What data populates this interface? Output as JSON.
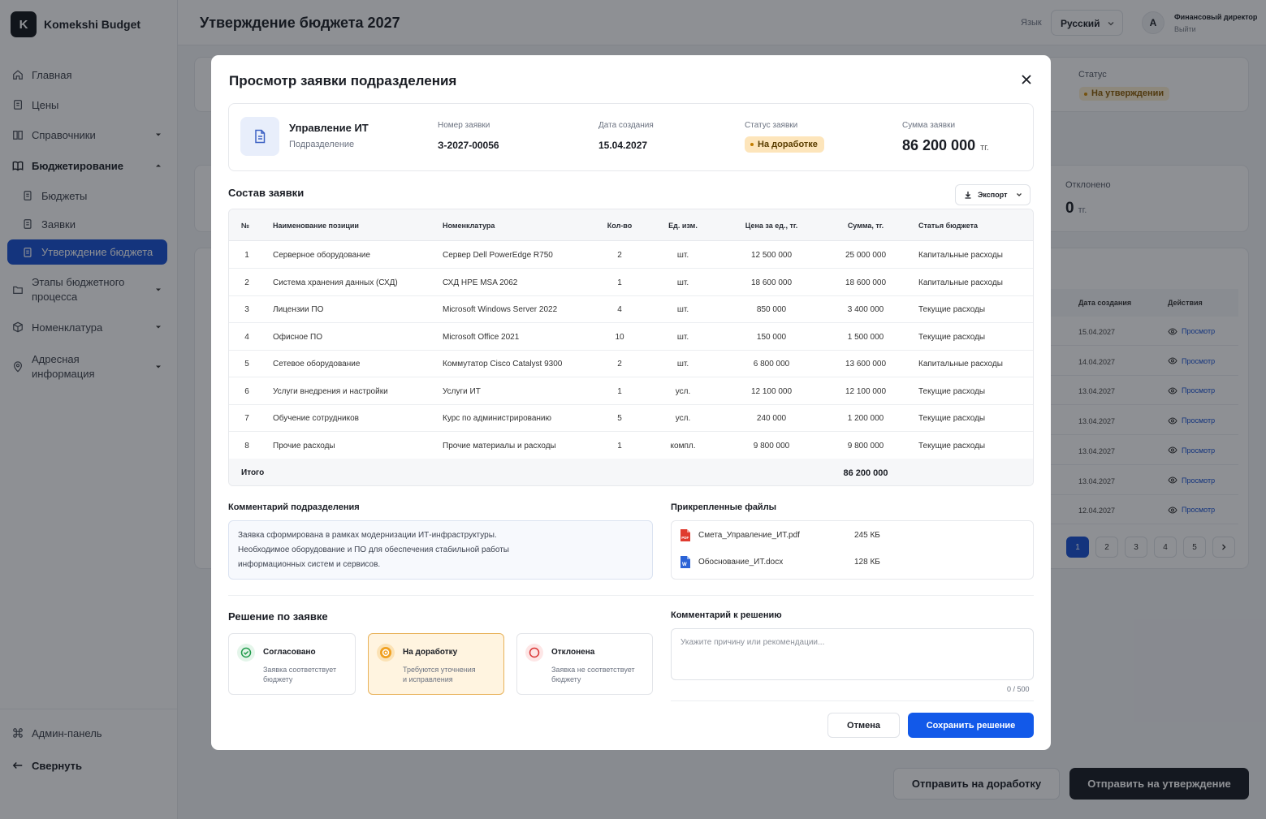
{
  "app": {
    "name": "Komekshi Budget",
    "logo_letter": "K"
  },
  "sidebar": {
    "items": [
      {
        "label": "Главная",
        "icon": "home-icon"
      },
      {
        "label": "Цены",
        "icon": "price-doc-icon"
      },
      {
        "label": "Справочники",
        "icon": "book-icon"
      },
      {
        "label": "Бюджетирование",
        "icon": "book-open-icon"
      },
      {
        "label": "Бюджеты",
        "icon": "file-icon"
      },
      {
        "label": "Заявки",
        "icon": "file-icon"
      },
      {
        "label": "Утверждение бюджета",
        "icon": "file-icon"
      },
      {
        "label": "Этапы бюджетного процесса",
        "icon": "folder-icon"
      },
      {
        "label": "Номенклатура",
        "icon": "box-icon"
      },
      {
        "label": "Адресная информация",
        "icon": "map-pin-icon"
      }
    ],
    "admin": "Админ-панель",
    "collapse": "Свернуть"
  },
  "header": {
    "title": "Утверждение бюджета 2027",
    "lang_label": "Язык",
    "lang_value": "Русский",
    "avatar": "А",
    "user_role": "Финансовый директор",
    "logout": "Выйти"
  },
  "background": {
    "status_label": "Статус",
    "status_value": "На утверждении",
    "rejected_label": "Отклонено",
    "rejected_value": "0",
    "currency": "тг.",
    "table_headers": [
      "Дата создания",
      "Действия"
    ],
    "rows": [
      {
        "date": "15.04.2027",
        "action": "Просмотр"
      },
      {
        "date": "14.04.2027",
        "action": "Просмотр"
      },
      {
        "date": "13.04.2027",
        "action": "Просмотр"
      },
      {
        "date": "13.04.2027",
        "action": "Просмотр"
      },
      {
        "date": "13.04.2027",
        "action": "Просмотр"
      },
      {
        "date": "13.04.2027",
        "action": "Просмотр"
      },
      {
        "date": "12.04.2027",
        "action": "Просмотр"
      }
    ],
    "pages": [
      "1",
      "2",
      "3",
      "4",
      "5"
    ],
    "btn_rework": "Отправить на доработку",
    "btn_approve": "Отправить на утверждение"
  },
  "modal": {
    "title": "Просмотр заявки подразделения",
    "department": "Управление ИТ",
    "department_sub": "Подразделение",
    "number_label": "Номер заявки",
    "number_value": "З-2027-00056",
    "date_label": "Дата создания",
    "date_value": "15.04.2027",
    "status_label": "Статус заявки",
    "status_value": "На доработке",
    "sum_label": "Сумма заявки",
    "sum_value": "86 200 000",
    "currency": "тг.",
    "composition_title": "Состав заявки",
    "export_label": "Экспорт",
    "columns": [
      "№",
      "Наименование позиции",
      "Номенклатура",
      "Кол-во",
      "Ед. изм.",
      "Цена за ед., тг.",
      "Сумма, тг.",
      "Статья бюджета"
    ],
    "rows": [
      {
        "n": "1",
        "name": "Серверное оборудование",
        "nom": "Сервер Dell PowerEdge R750",
        "qty": "2",
        "unit": "шт.",
        "price": "12 500 000",
        "sum": "25 000 000",
        "article": "Капитальные расходы"
      },
      {
        "n": "2",
        "name": "Система хранения данных (СХД)",
        "nom": "СХД HPE MSA 2062",
        "qty": "1",
        "unit": "шт.",
        "price": "18 600 000",
        "sum": "18 600 000",
        "article": "Капитальные расходы"
      },
      {
        "n": "3",
        "name": "Лицензии ПО",
        "nom": "Microsoft Windows Server 2022",
        "qty": "4",
        "unit": "шт.",
        "price": "850 000",
        "sum": "3 400 000",
        "article": "Текущие расходы"
      },
      {
        "n": "4",
        "name": "Офисное ПО",
        "nom": "Microsoft Office 2021",
        "qty": "10",
        "unit": "шт.",
        "price": "150 000",
        "sum": "1 500 000",
        "article": "Текущие расходы"
      },
      {
        "n": "5",
        "name": "Сетевое оборудование",
        "nom": "Коммутатор Cisco Catalyst 9300",
        "qty": "2",
        "unit": "шт.",
        "price": "6 800 000",
        "sum": "13 600 000",
        "article": "Капитальные расходы"
      },
      {
        "n": "6",
        "name": "Услуги внедрения и настройки",
        "nom": "Услуги ИТ",
        "qty": "1",
        "unit": "усл.",
        "price": "12 100 000",
        "sum": "12 100 000",
        "article": "Текущие расходы"
      },
      {
        "n": "7",
        "name": "Обучение сотрудников",
        "nom": "Курс по администрированию",
        "qty": "5",
        "unit": "усл.",
        "price": "240 000",
        "sum": "1 200 000",
        "article": "Текущие расходы"
      },
      {
        "n": "8",
        "name": "Прочие расходы",
        "nom": "Прочие материалы и расходы",
        "qty": "1",
        "unit": "компл.",
        "price": "9 800 000",
        "sum": "9 800 000",
        "article": "Текущие расходы"
      }
    ],
    "total_label": "Итого",
    "total_value": "86 200 000",
    "comment_title": "Комментарий подразделения",
    "comment_lines": [
      "Заявка сформирована в рамках модернизации ИТ-инфраструктуры.",
      "Необходимое оборудование и ПО для обеспечения стабильной работы",
      "информационных систем и сервисов."
    ],
    "files_title": "Прикрепленные файлы",
    "files": [
      {
        "name": "Смета_Управление_ИТ.pdf",
        "size": "245 КБ",
        "icon": "pdf-file-icon"
      },
      {
        "name": "Обоснование_ИТ.docx",
        "size": "128 КБ",
        "icon": "word-file-icon"
      }
    ],
    "decision_title": "Решение по заявке",
    "options": [
      {
        "title": "Согласовано",
        "desc1": "Заявка соответствует",
        "desc2": "бюджету"
      },
      {
        "title": "На доработку",
        "desc1": "Требуются уточнения",
        "desc2": "и исправления"
      },
      {
        "title": "Отклонена",
        "desc1": "Заявка не соответствует",
        "desc2": "бюджету"
      }
    ],
    "decision_comment_title": "Комментарий к решению",
    "decision_placeholder": "Укажите причину или рекомендации...",
    "counter": "0 / 500",
    "cancel": "Отмена",
    "save": "Сохранить решение"
  },
  "colors": {
    "primary": "#1650d4",
    "save": "#1259e9",
    "warning_bg": "#fde5bb",
    "dark": "#111418"
  }
}
